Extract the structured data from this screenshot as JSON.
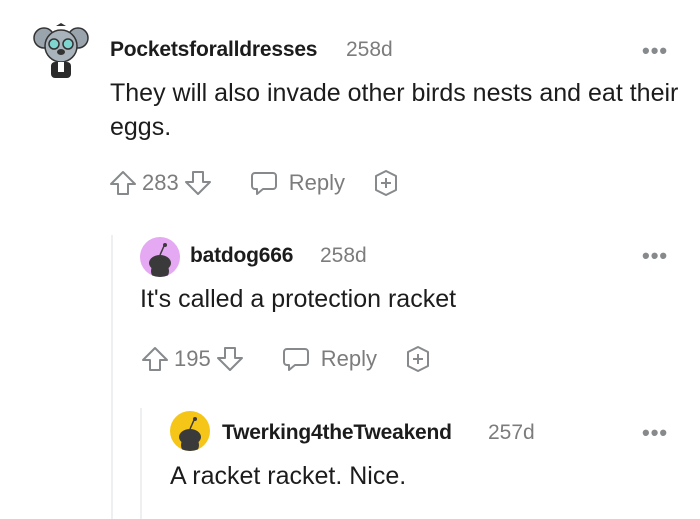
{
  "comments": [
    {
      "author": "Pocketsforalldresses",
      "age": "258d",
      "body": "They will also invade other birds nests and eat their eggs.",
      "score": "283",
      "reply_label": "Reply",
      "more_label": "•••",
      "avatar_icon": "koala-avatar-icon"
    },
    {
      "author": "batdog666",
      "age": "258d",
      "body": "It's called a protection racket",
      "score": "195",
      "reply_label": "Reply",
      "more_label": "•••",
      "avatar_icon": "snoo-avatar-icon",
      "avatar_color": "#e5a8f2"
    },
    {
      "author": "Twerking4theTweakend",
      "age": "257d",
      "body": "A racket racket. Nice.",
      "more_label": "•••",
      "avatar_icon": "snoo-avatar-icon",
      "avatar_color": "#f5c518"
    }
  ],
  "colors": {
    "text": "#1c1c1c",
    "meta": "#7c7c7c",
    "icon": "#878a8c",
    "thread_line": "#edeff1"
  }
}
